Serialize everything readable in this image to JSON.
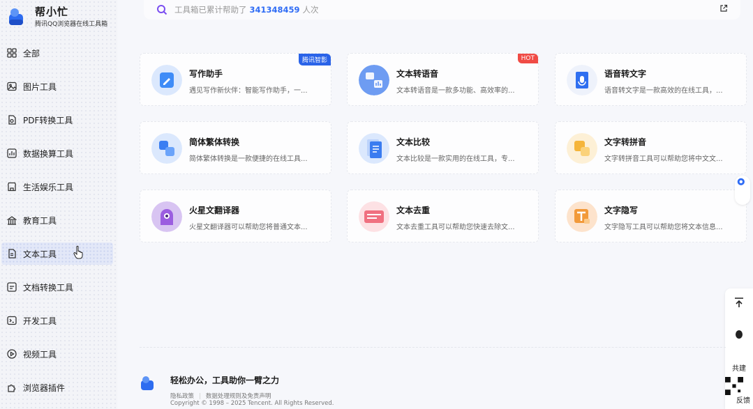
{
  "brand": {
    "name": "帮小忙",
    "subtitle": "腾讯QQ浏览器在线工具箱"
  },
  "nav": {
    "items": [
      {
        "label": "全部",
        "icon": "grid-icon"
      },
      {
        "label": "图片工具",
        "icon": "image-icon"
      },
      {
        "label": "PDF转换工具",
        "icon": "pdf-icon"
      },
      {
        "label": "数据换算工具",
        "icon": "chart-icon"
      },
      {
        "label": "生活娱乐工具",
        "icon": "shop-icon"
      },
      {
        "label": "教育工具",
        "icon": "school-icon"
      },
      {
        "label": "文本工具",
        "icon": "text-icon"
      },
      {
        "label": "文档转换工具",
        "icon": "doc-convert-icon"
      },
      {
        "label": "开发工具",
        "icon": "terminal-icon"
      },
      {
        "label": "视频工具",
        "icon": "video-icon"
      },
      {
        "label": "浏览器插件",
        "icon": "plugin-icon"
      }
    ],
    "active": "文本工具"
  },
  "search": {
    "prefix": "工具箱已累计帮助了",
    "count": "341348459",
    "suffix": "人次"
  },
  "cards": [
    {
      "title": "写作助手",
      "desc": "遇见写作新伙伴：智能写作助手，一...",
      "badge": "腾讯智影",
      "badge_color": "#2a63e8",
      "icon_color": "#3f8cf7"
    },
    {
      "title": "文本转语音",
      "desc": "文本转语音是一款多功能、高效率的...",
      "badge": "HOT",
      "badge_color": "#f04b45",
      "icon_color": "#5a8ff2"
    },
    {
      "title": "语音转文字",
      "desc": "语音转文字是一款高效的在线工具，...",
      "badge": "",
      "icon_color": "#2f6ff0"
    },
    {
      "title": "简体繁体转换",
      "desc": "简体繁体转换是一款便捷的在线工具...",
      "badge": "",
      "icon_color": "#3a7ef2"
    },
    {
      "title": "文本比较",
      "desc": "文本比较是一款实用的在线工具，专...",
      "badge": "",
      "icon_color": "#3a7cf0"
    },
    {
      "title": "文字转拼音",
      "desc": "文字转拼音工具可以帮助您将中文文...",
      "badge": "",
      "icon_color": "#f5b53a"
    },
    {
      "title": "火星文翻译器",
      "desc": "火星文翻译器可以帮助您将普通文本...",
      "badge": "",
      "icon_color": "#9b5de0"
    },
    {
      "title": "文本去重",
      "desc": "文本去重工具可以帮助您快速去除文...",
      "badge": "",
      "icon_color": "#f07080"
    },
    {
      "title": "文字隐写",
      "desc": "文字隐写工具可以帮助您将文本信息...",
      "badge": "",
      "icon_color": "#f29a3a"
    }
  ],
  "float_bar": {
    "top_label": "共建",
    "feedback_label": "反馈"
  },
  "footer": {
    "slogan": "轻松办公，工具助你一臂之力",
    "link_privacy": "隐私政策",
    "link_rules": "数据处理规则及免责声明",
    "copyright": "Copyright © 1998 – 2025 Tencent. All Rights Reserved."
  }
}
